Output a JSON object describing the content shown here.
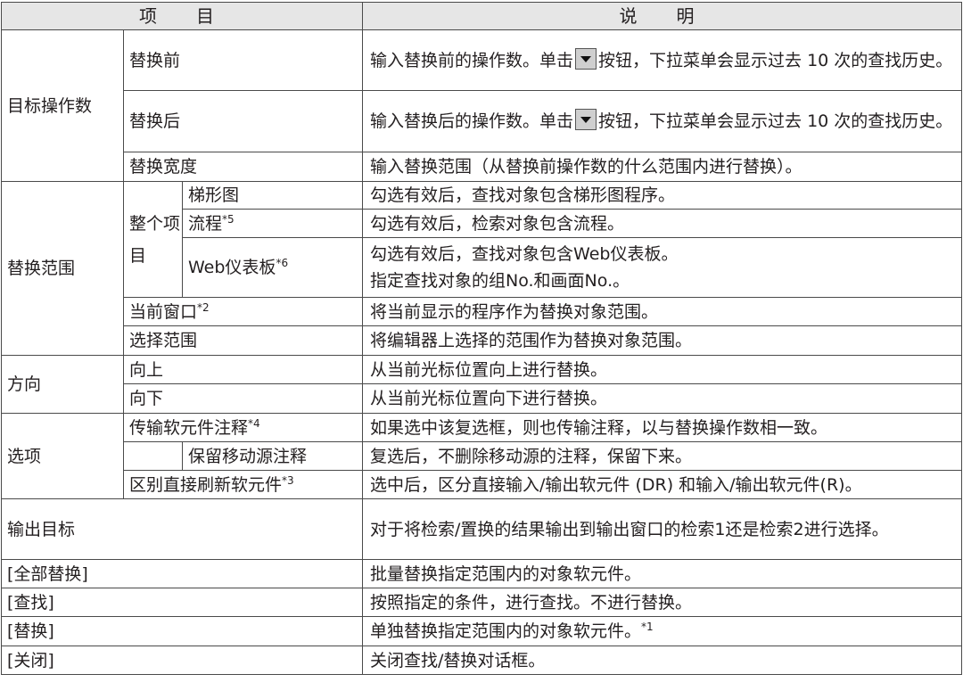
{
  "header": {
    "item": "项　目",
    "description": "说　明"
  },
  "rows": {
    "target_operand": {
      "label": "目标操作数",
      "before": {
        "label": "替换前",
        "desc_pre": "输入替换前的操作数。单击",
        "desc_post": "按钮，下拉菜单会显示过去 10 次的查找历史。"
      },
      "after": {
        "label": "替换后",
        "desc_pre": "输入替换后的操作数。单击",
        "desc_post": "按钮，下拉菜单会显示过去 10 次的查找历史。"
      },
      "width": {
        "label": "替换宽度",
        "desc": "输入替换范围（从替换前操作数的什么范围内进行替换）。"
      }
    },
    "replace_range": {
      "label": "替换范围",
      "all_items": "整个项目",
      "ladder": {
        "label": "梯形图",
        "desc": "勾选有效后，查找对象包含梯形图程序。"
      },
      "flow": {
        "label": "流程",
        "note": "*5",
        "desc": "勾选有效后，检索对象包含流程。"
      },
      "web": {
        "label": "Web仪表板",
        "note": "*6",
        "desc_1": "勾选有效后，查找对象包含Web仪表板。",
        "desc_2": "指定查找对象的组No.和画面No.。"
      },
      "current_window": {
        "label": "当前窗口",
        "note": "*2",
        "desc": "将当前显示的程序作为替换对象范围。"
      },
      "selection": {
        "label": "选择范围",
        "desc": "将编辑器上选择的范围作为替换对象范围。"
      }
    },
    "direction": {
      "label": "方向",
      "up": {
        "label": "向上",
        "desc": "从当前光标位置向上进行替换。"
      },
      "down": {
        "label": "向下",
        "desc": "从当前光标位置向下进行替换。"
      }
    },
    "options": {
      "label": "选项",
      "transfer": {
        "label": "传输软元件注释",
        "note": "*4",
        "desc": "如果选中该复选框，则也传输注释，以与替换操作数相一致。"
      },
      "keep": {
        "label": "保留移动源注释",
        "desc": "复选后，不删除移动源的注释，保留下来。"
      },
      "refresh": {
        "label": "区别直接刷新软元件",
        "note": "*3",
        "desc": "选中后，区分直接输入/输出软元件 (DR) 和输入/输出软元件(R)。"
      }
    },
    "output_target": {
      "label": "输出目标",
      "desc": "对于将检索/置换的结果输出到输出窗口的检索1还是检索2进行选择。"
    },
    "replace_all": {
      "label": "[全部替换]",
      "desc": "批量替换指定范围内的对象软元件。"
    },
    "find": {
      "label": "[查找]",
      "desc": "按照指定的条件，进行查找。不进行替换。"
    },
    "replace": {
      "label": "[替换]",
      "desc": "单独替换指定范围内的对象软元件。",
      "note": "*1"
    },
    "close": {
      "label": "[关闭]",
      "desc": "关闭查找/替换对话框。"
    }
  },
  "icons": {
    "dropdown": "dropdown-arrow-icon"
  }
}
